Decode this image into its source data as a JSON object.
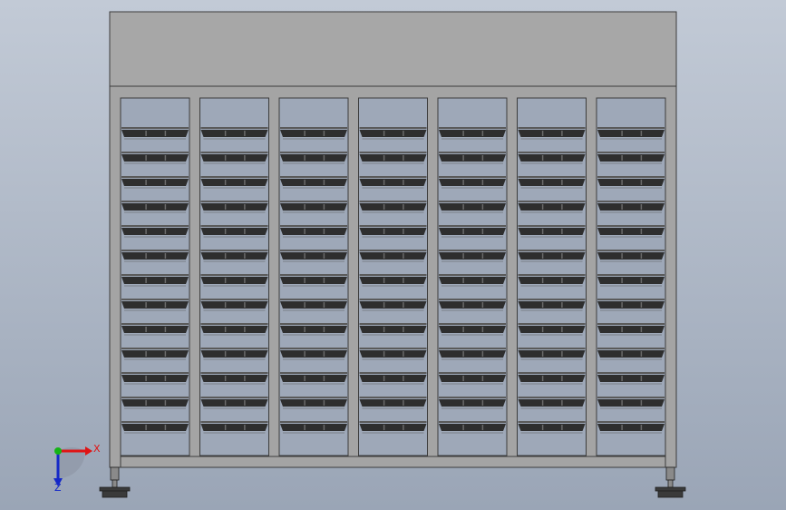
{
  "viewport": {
    "background_top": "#c2cad6",
    "background_bottom": "#9aa5b6"
  },
  "model": {
    "frame_color": "#a4a4a4",
    "frame_edge_color": "#3c3c3c",
    "header_panel_color": "#a7a7a7",
    "opening_color": "#9ea8b8",
    "tray_color": "#2e2e2e",
    "tray_lip_color": "#5a5a5a",
    "column_count": 7,
    "tray_rows": 13
  },
  "triad": {
    "x_label": "X",
    "z_label": "Z",
    "x_color": "#e01414",
    "y_color": "#14b414",
    "z_color": "#1428c8"
  }
}
